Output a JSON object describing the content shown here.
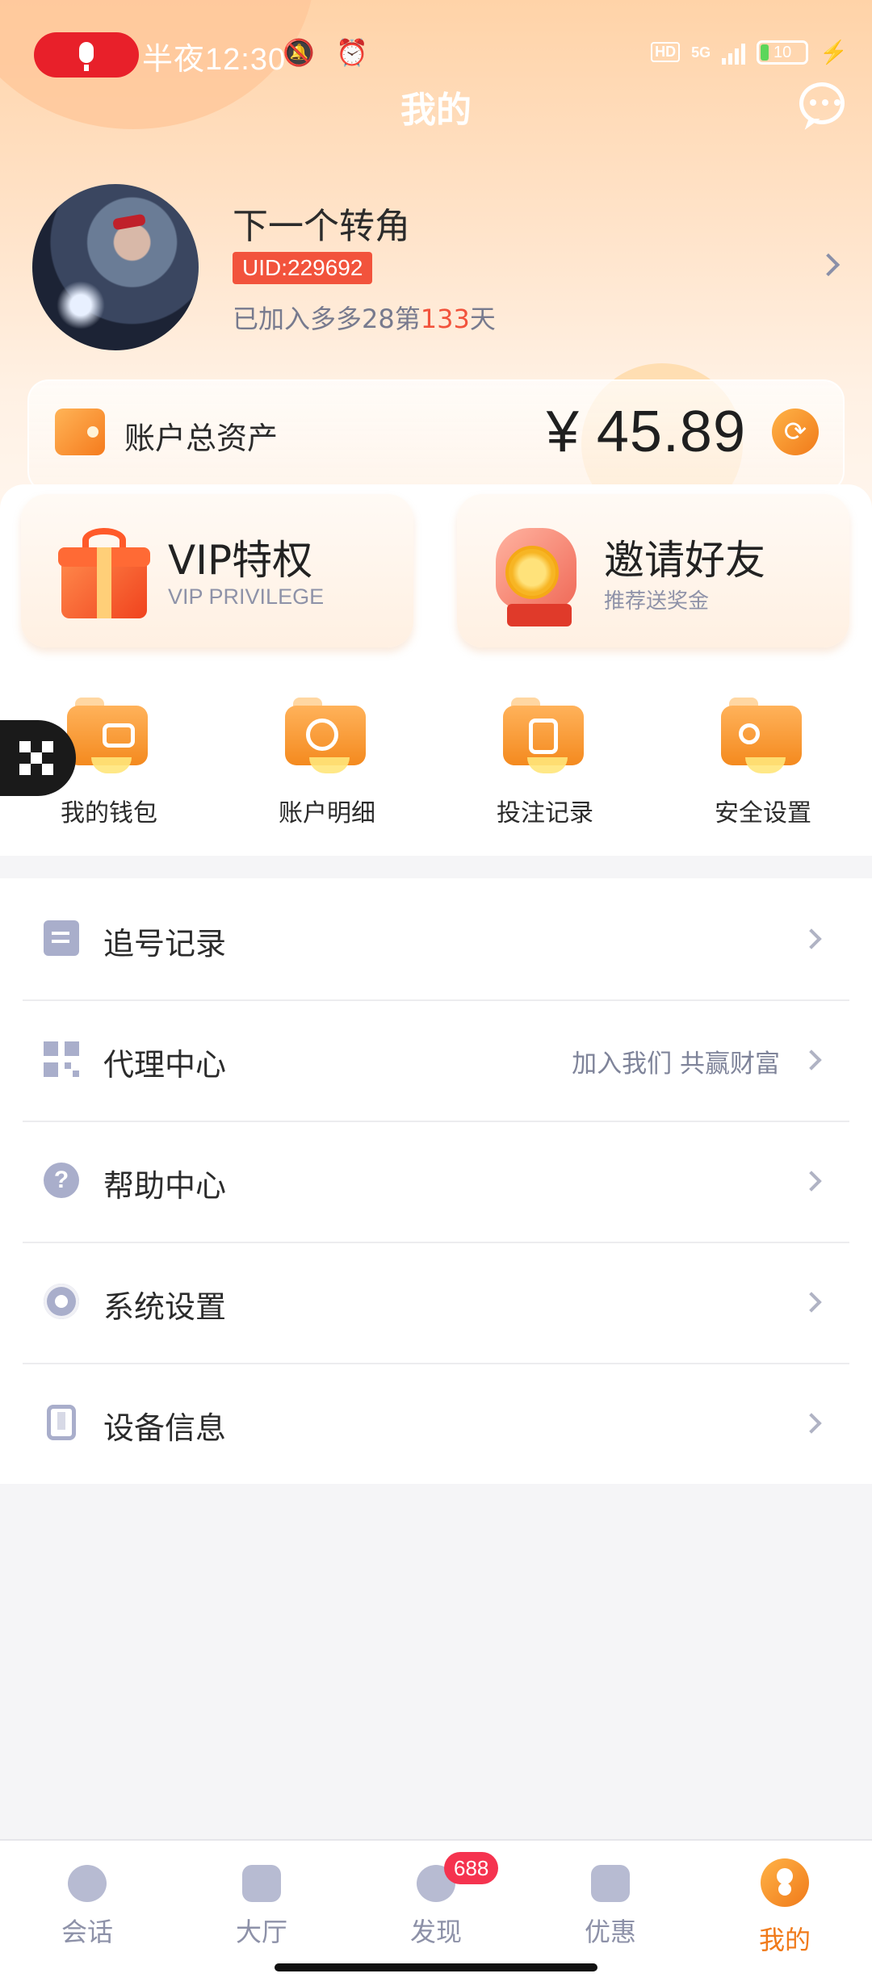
{
  "status_bar": {
    "time": "半夜12:30",
    "network": "5G",
    "hd": "HD",
    "battery": "10",
    "icons": [
      "microphone-icon",
      "mute-icon",
      "alarm-icon",
      "signal-icon",
      "battery-icon",
      "charging-icon"
    ]
  },
  "header": {
    "title": "我的",
    "message_icon": "chat-bubble-icon"
  },
  "profile": {
    "username": "下一个转角",
    "uid": "UID:229692",
    "joined_prefix": "已加入多多28第",
    "joined_days": "133",
    "joined_suffix": "天"
  },
  "assets": {
    "label": "账户总资产",
    "amount": "¥ 45.89",
    "refresh_icon": "refresh-icon"
  },
  "promos": [
    {
      "title": "VIP特权",
      "subtitle": "VIP PRIVILEGE",
      "icon": "gift-icon"
    },
    {
      "title": "邀请好友",
      "subtitle": "推荐送奖金",
      "icon": "coin-hand-icon"
    }
  ],
  "quick_actions": [
    {
      "label": "我的钱包",
      "icon": "wallet-icon"
    },
    {
      "label": "账户明细",
      "icon": "search-icon"
    },
    {
      "label": "投注记录",
      "icon": "document-icon"
    },
    {
      "label": "安全设置",
      "icon": "key-icon"
    }
  ],
  "menu": [
    {
      "label": "追号记录",
      "note": "",
      "icon": "record-icon"
    },
    {
      "label": "代理中心",
      "note": "加入我们 共赢财富",
      "icon": "qr-code-icon"
    },
    {
      "label": "帮助中心",
      "note": "",
      "icon": "help-icon"
    },
    {
      "label": "系统设置",
      "note": "",
      "icon": "gear-icon"
    },
    {
      "label": "设备信息",
      "note": "",
      "icon": "phone-icon"
    }
  ],
  "bottom_nav": [
    {
      "label": "会话",
      "icon": "chat-icon",
      "badge": ""
    },
    {
      "label": "大厅",
      "icon": "bank-icon",
      "badge": ""
    },
    {
      "label": "发现",
      "icon": "compass-icon",
      "badge": "688"
    },
    {
      "label": "优惠",
      "icon": "yen-icon",
      "badge": ""
    },
    {
      "label": "我的",
      "icon": "user-icon",
      "badge": "",
      "active": true
    }
  ],
  "colors": {
    "accent": "#F07A1A",
    "uid_badge": "#F2533C",
    "nav_badge": "#F5334F",
    "recording_pill": "#E8202A"
  }
}
